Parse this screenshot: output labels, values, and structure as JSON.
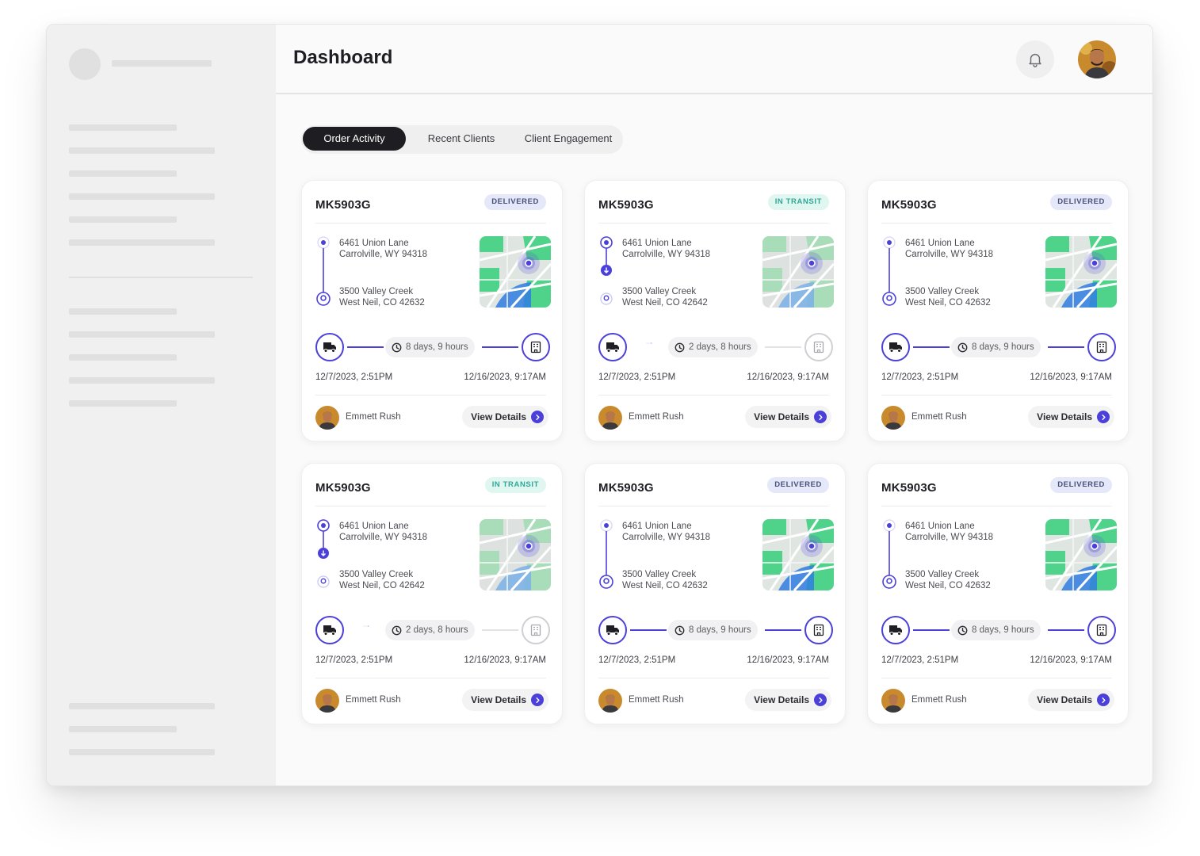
{
  "header": {
    "title": "Dashboard"
  },
  "tabs": [
    {
      "label": "Order Activity",
      "active": true
    },
    {
      "label": "Recent Clients",
      "active": false
    },
    {
      "label": "Client Engagement",
      "active": false
    }
  ],
  "colors": {
    "accent": "#4b40d9",
    "delivered_badge": "#e4e8f8",
    "transit_badge": "#dff6f1",
    "active_tab": "#1e1e22"
  },
  "cards": [
    {
      "id": "MK5903G",
      "status": "DELIVERED",
      "from_line1": "6461 Union Lane",
      "from_line2": "Carrolville, WY 94318",
      "to_line1": "3500 Valley Creek",
      "to_line2": "West Neil, CO 42632",
      "duration": "8 days, 9 hours",
      "start": "12/7/2023, 2:51PM",
      "end": "12/16/2023, 9:17AM",
      "owner": "Emmett Rush",
      "action": "View Details"
    },
    {
      "id": "MK5903G",
      "status": "IN TRANSIT",
      "from_line1": "6461 Union Lane",
      "from_line2": "Carrolville, WY 94318",
      "to_line1": "3500 Valley Creek",
      "to_line2": "West Neil, CO 42642",
      "duration": "2 days, 8 hours",
      "start": "12/7/2023, 2:51PM",
      "end": "12/16/2023, 9:17AM",
      "owner": "Emmett Rush",
      "action": "View Details"
    },
    {
      "id": "MK5903G",
      "status": "DELIVERED",
      "from_line1": "6461 Union Lane",
      "from_line2": "Carrolville, WY 94318",
      "to_line1": "3500 Valley Creek",
      "to_line2": "West Neil, CO 42632",
      "duration": "8 days, 9 hours",
      "start": "12/7/2023, 2:51PM",
      "end": "12/16/2023, 9:17AM",
      "owner": "Emmett Rush",
      "action": "View Details"
    },
    {
      "id": "MK5903G",
      "status": "IN TRANSIT",
      "from_line1": "6461 Union Lane",
      "from_line2": "Carrolville, WY 94318",
      "to_line1": "3500 Valley Creek",
      "to_line2": "West Neil, CO 42642",
      "duration": "2 days, 8 hours",
      "start": "12/7/2023, 2:51PM",
      "end": "12/16/2023, 9:17AM",
      "owner": "Emmett Rush",
      "action": "View Details"
    },
    {
      "id": "MK5903G",
      "status": "DELIVERED",
      "from_line1": "6461 Union Lane",
      "from_line2": "Carrolville, WY 94318",
      "to_line1": "3500 Valley Creek",
      "to_line2": "West Neil, CO 42632",
      "duration": "8 days, 9 hours",
      "start": "12/7/2023, 2:51PM",
      "end": "12/16/2023, 9:17AM",
      "owner": "Emmett Rush",
      "action": "View Details"
    },
    {
      "id": "MK5903G",
      "status": "DELIVERED",
      "from_line1": "6461 Union Lane",
      "from_line2": "Carrolville, WY 94318",
      "to_line1": "3500 Valley Creek",
      "to_line2": "West Neil, CO 42632",
      "duration": "8 days, 9 hours",
      "start": "12/7/2023, 2:51PM",
      "end": "12/16/2023, 9:17AM",
      "owner": "Emmett Rush",
      "action": "View Details"
    }
  ]
}
